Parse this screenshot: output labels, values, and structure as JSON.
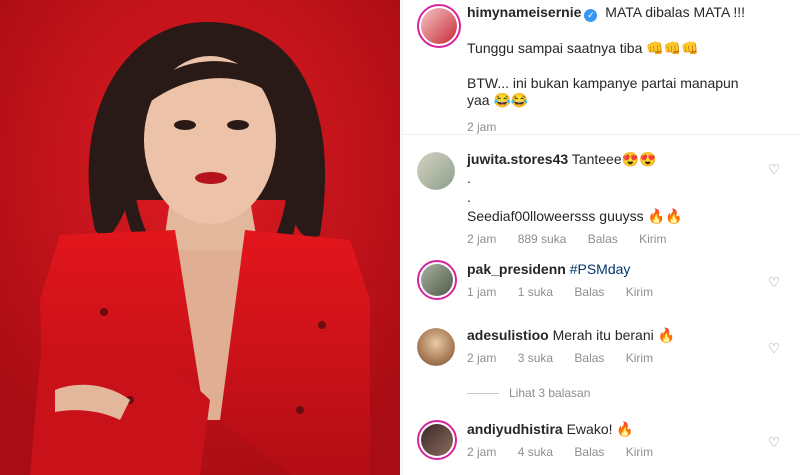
{
  "post": {
    "author": "himynameisernie",
    "verified_glyph": "✓",
    "caption_line1": "MATA dibalas MATA !!!",
    "caption_line2": "Tunggu sampai saatnya tiba 👊👊👊",
    "caption_line3": "BTW... ini bukan kampanye partai manapun yaa 😂😂",
    "time": "2 jam"
  },
  "comments": [
    {
      "username": "juwita.stores43",
      "text": "Tanteee😍😍",
      "text_line2": ".",
      "text_line3": ".",
      "text_line4": "Seediaf00lloweersss guuyss 🔥🔥",
      "time": "2 jam",
      "likes": "889 suka",
      "reply": "Balas",
      "send": "Kirim"
    },
    {
      "username": "pak_presidenn",
      "hashtag": "#PSMday",
      "time": "1 jam",
      "likes": "1 suka",
      "reply": "Balas",
      "send": "Kirim"
    },
    {
      "username": "adesulistioo",
      "text": "Merah itu berani 🔥",
      "time": "2 jam",
      "likes": "3 suka",
      "reply": "Balas",
      "send": "Kirim"
    },
    {
      "username": "andiyudhistira",
      "text": "Ewako! 🔥",
      "time": "2 jam",
      "likes": "4 suka",
      "reply": "Balas",
      "send": "Kirim"
    }
  ],
  "view_replies": "Lihat 3 balasan",
  "icons": {
    "heart": "♡"
  },
  "colors": {
    "accent": "#3897f0",
    "photo_bg": "#c8101a",
    "link": "#00376b"
  }
}
